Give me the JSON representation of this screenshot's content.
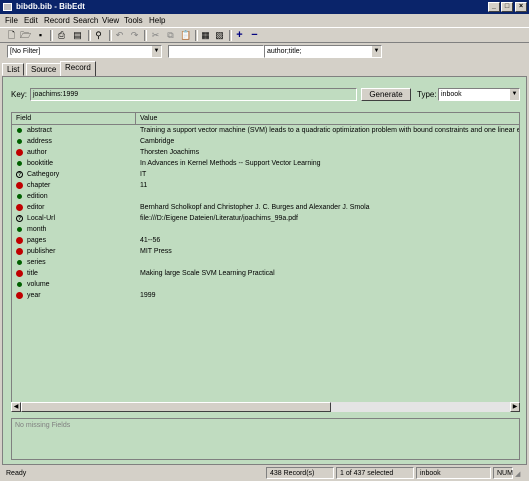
{
  "window": {
    "title": "bibdb.bib - BibEdt"
  },
  "menu": [
    "File",
    "Edit",
    "Record",
    "Search",
    "View",
    "Tools",
    "Help"
  ],
  "toolbar": {
    "icons": [
      "new-icon",
      "open-icon",
      "save-icon",
      "print-icon",
      "print-preview-icon",
      "find-icon",
      "undo-icon",
      "redo-icon",
      "cut-icon",
      "copy-icon",
      "paste-icon",
      "export-icon",
      "import-icon",
      "add-record-icon",
      "delete-record-icon"
    ],
    "add": "+",
    "remove": "−"
  },
  "filter": {
    "value": "[No Filter]",
    "search_value": "",
    "search_field": "author;title;"
  },
  "tabs": [
    "List",
    "Source",
    "Record"
  ],
  "record": {
    "key_label": "Key:",
    "key_value": "joachims:1999",
    "generate_label": "Generate",
    "type_label": "Type:",
    "type_value": "inbook"
  },
  "grid": {
    "columns": [
      "Field",
      "Value"
    ],
    "rows": [
      {
        "field": "abstract",
        "value": "Training a support vector machine (SVM) leads to a quadratic optimization problem with bound constraints and one linear equ",
        "status": "ok"
      },
      {
        "field": "address",
        "value": "Cambridge",
        "status": "ok"
      },
      {
        "field": "author",
        "value": "Thorsten Joachims",
        "status": "required"
      },
      {
        "field": "booktitle",
        "value": "In Advances in Kernel Methods -- Support Vector Learning",
        "status": "ok"
      },
      {
        "field": "Cathegory",
        "value": "IT",
        "status": "unknown"
      },
      {
        "field": "chapter",
        "value": "11",
        "status": "required"
      },
      {
        "field": "edition",
        "value": "",
        "status": "ok"
      },
      {
        "field": "editor",
        "value": "Bernhard Scholkopf and Christopher J. C. Burges and Alexander J. Smola",
        "status": "required"
      },
      {
        "field": "Local-Url",
        "value": "file:///D:/Eigene Dateien/Literatur/joachims_99a.pdf",
        "status": "unknown"
      },
      {
        "field": "month",
        "value": "",
        "status": "ok"
      },
      {
        "field": "pages",
        "value": "41--56",
        "status": "required"
      },
      {
        "field": "publisher",
        "value": "MIT Press",
        "status": "required"
      },
      {
        "field": "series",
        "value": "",
        "status": "ok"
      },
      {
        "field": "title",
        "value": "Making large Scale SVM Learning Practical",
        "status": "required"
      },
      {
        "field": "volume",
        "value": "",
        "status": "ok"
      },
      {
        "field": "year",
        "value": "1999",
        "status": "required"
      }
    ]
  },
  "missing_fields_text": "No missing Fields",
  "status": {
    "ready": "Ready",
    "records": "438 Record(s)",
    "selected": "1 of 437 selected",
    "type": "inbook",
    "num": "NUM"
  },
  "colors": {
    "title_bar": "#0a246a",
    "panel_green": "#c0dcc0",
    "required_icon": "#c00000",
    "ok_icon": "#006000"
  }
}
